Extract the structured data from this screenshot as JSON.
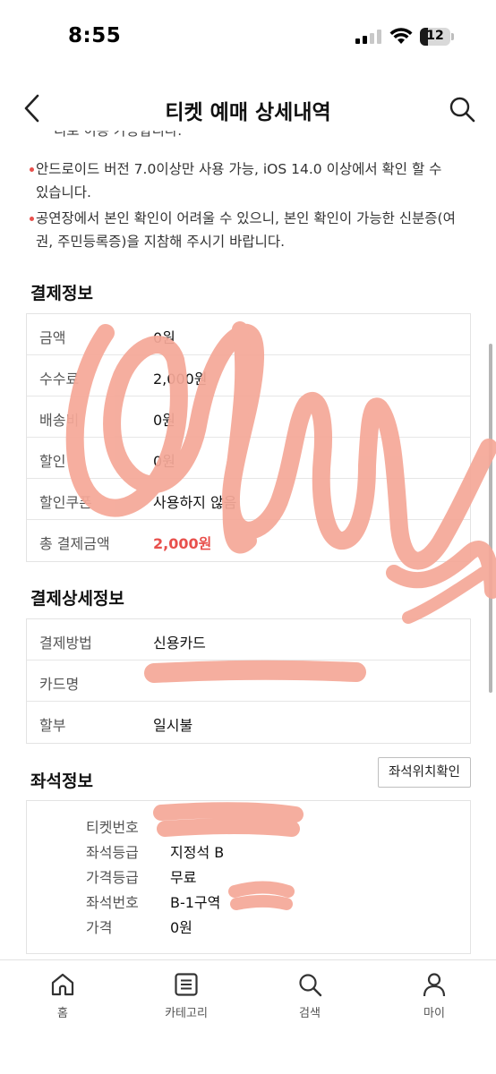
{
  "status_bar": {
    "time": "8:55",
    "battery": "12"
  },
  "header": {
    "title": "티켓 예매 상세내역"
  },
  "notices": {
    "cut_off_line": "리로 이용 가능합니다.",
    "items": [
      "안드로이드 버전 7.0이상만 사용 가능, iOS 14.0 이상에서 확인 할 수 있습니다.",
      "공연장에서 본인 확인이 어려울 수 있으니, 본인 확인이 가능한 신분증(여권, 주민등록증)을 지참해 주시기 바랍니다."
    ]
  },
  "payment_info": {
    "title": "결제정보",
    "rows": [
      {
        "label": "금액",
        "value": "0원"
      },
      {
        "label": "수수료",
        "value": "2,000원"
      },
      {
        "label": "배송비",
        "value": "0원"
      },
      {
        "label": "할인",
        "value": "0원"
      },
      {
        "label": "할인쿠폰",
        "value": "사용하지 않음"
      },
      {
        "label": "총 결제금액",
        "value": "2,000원"
      }
    ]
  },
  "payment_detail": {
    "title": "결제상세정보",
    "rows": [
      {
        "label": "결제방법",
        "value": "신용카드"
      },
      {
        "label": "카드명",
        "value": ""
      },
      {
        "label": "할부",
        "value": "일시불"
      }
    ]
  },
  "seat_info": {
    "title": "좌석정보",
    "button_label": "좌석위치확인",
    "rows": [
      {
        "label": "티켓번호",
        "value": ""
      },
      {
        "label": "좌석등급",
        "value": "지정석 B"
      },
      {
        "label": "가격등급",
        "value": "무료"
      },
      {
        "label": "좌석번호",
        "value": "B-1구역"
      },
      {
        "label": "가격",
        "value": "0원"
      }
    ]
  },
  "tab_bar": {
    "tabs": [
      {
        "label": "홈",
        "icon": "home-icon"
      },
      {
        "label": "카테고리",
        "icon": "list-icon"
      },
      {
        "label": "검색",
        "icon": "search-icon"
      },
      {
        "label": "마이",
        "icon": "person-icon"
      }
    ]
  },
  "colors": {
    "accent": "#e8504c",
    "redaction": "#f5a898"
  }
}
